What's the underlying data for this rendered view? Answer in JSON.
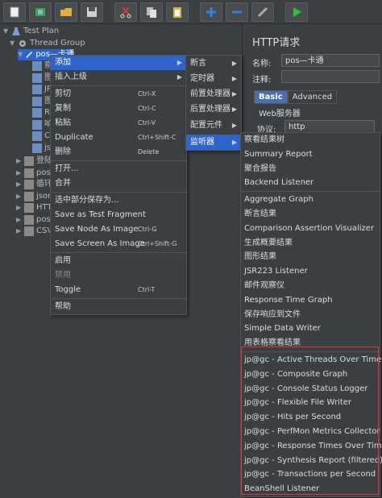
{
  "toolbar": {
    "buttons": [
      {
        "name": "new-icon",
        "color": "#f0f0f0"
      },
      {
        "name": "templates-icon",
        "color": "#3aa34a"
      },
      {
        "name": "open-icon",
        "color": "#e0b040"
      },
      {
        "name": "save-icon",
        "color": "#d0d0d0"
      },
      {
        "name": "cut-icon",
        "color": "#d23c3c"
      },
      {
        "name": "copy-icon",
        "color": "#d0d0d0"
      },
      {
        "name": "paste-icon",
        "color": "#e0b040"
      },
      {
        "name": "expand-icon",
        "color": "#3a7fd6"
      },
      {
        "name": "collapse-icon",
        "color": "#3a7fd6"
      },
      {
        "name": "toggle-icon",
        "color": "#aaaaaa"
      },
      {
        "name": "start-icon",
        "color": "#2fbf3f"
      }
    ]
  },
  "tree": {
    "test_plan": "Test Plan",
    "thread_group": "Thread Group",
    "selected_node": "pos—卡通",
    "children": [
      "察",
      "图",
      "JP",
      "图",
      "Re",
      "响",
      "CS",
      "jsc"
    ],
    "more": [
      "登陆",
      "pos",
      "循环",
      "json",
      "HTT",
      "pos",
      "CSV"
    ]
  },
  "right": {
    "title": "HTTP请求",
    "name_label": "名称:",
    "name_value": "pos—卡通",
    "comment_label": "注释:",
    "tab_basic": "Basic",
    "tab_advanced": "Advanced",
    "web_server": "Web服务器",
    "protocol_label": "协议:",
    "protocol_value": "http"
  },
  "menu": {
    "items": [
      {
        "label": "添加",
        "submenu": true
      },
      {
        "label": "插入上级",
        "submenu": true
      },
      {
        "label": "剪切",
        "shortcut": "Ctrl-X"
      },
      {
        "label": "复制",
        "shortcut": "Ctrl-C"
      },
      {
        "label": "粘贴",
        "shortcut": "Ctrl-V"
      },
      {
        "label": "Duplicate",
        "shortcut": "Ctrl+Shift-C"
      },
      {
        "label": "删除",
        "shortcut": "Delete"
      },
      {
        "label": "打开..."
      },
      {
        "label": "合并"
      },
      {
        "label": "选中部分保存为..."
      },
      {
        "label": "Save as Test Fragment"
      },
      {
        "label": "Save Node As Image",
        "shortcut": "Ctrl-G"
      },
      {
        "label": "Save Screen As Image",
        "shortcut": "Ctrl+Shift-G"
      },
      {
        "label": "启用"
      },
      {
        "label": "禁用"
      },
      {
        "label": "Toggle",
        "shortcut": "Ctrl-T"
      },
      {
        "label": "帮助"
      }
    ]
  },
  "submenu_add": {
    "items": [
      "断言",
      "定时器",
      "前置处理器",
      "后置处理器",
      "配置元件",
      "监听器"
    ]
  },
  "submenu_listener": {
    "items": [
      "察看结果树",
      "Summary Report",
      "聚合报告",
      "Backend Listener",
      "Aggregate Graph",
      "断言结果",
      "Comparison Assertion Visualizer",
      "生成概要结果",
      "图形结果",
      "JSR223 Listener",
      "邮件观察仪",
      "Response Time Graph",
      "保存响应到文件",
      "Simple Data Writer",
      "用表格察看结果",
      "jp@gc - Active Threads Over Time",
      "jp@gc - Composite Graph",
      "jp@gc - Console Status Logger",
      "jp@gc - Flexible File Writer",
      "jp@gc - Hits per Second",
      "jp@gc - PerfMon Metrics Collector",
      "jp@gc - Response Times Over Time",
      "jp@gc - Synthesis Report (filtered)",
      "jp@gc - Transactions per Second",
      "BeanShell Listener"
    ]
  },
  "colors": {
    "highlight": "#2f65ca",
    "red_box": "#d93a3a"
  }
}
